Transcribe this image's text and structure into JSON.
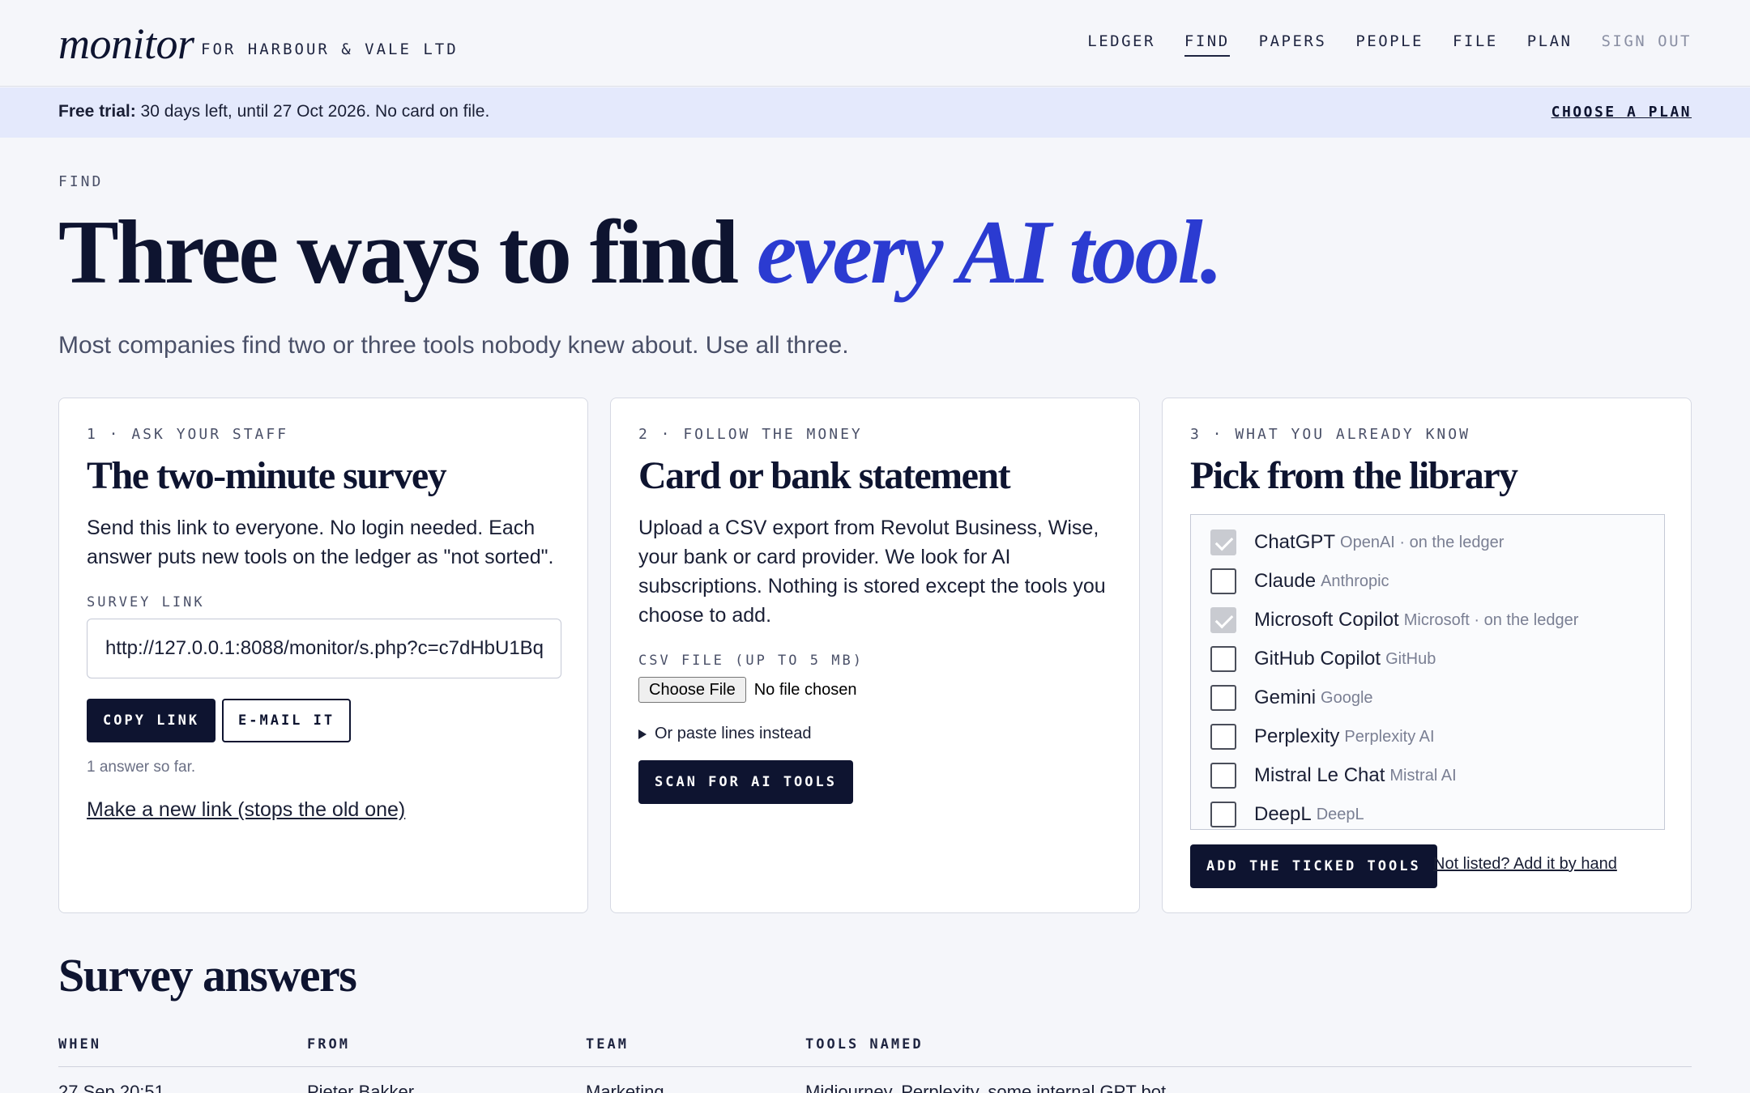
{
  "header": {
    "logo": "monitor",
    "org": "FOR HARBOUR & VALE LTD",
    "nav": [
      {
        "label": "LEDGER"
      },
      {
        "label": "FIND"
      },
      {
        "label": "PAPERS"
      },
      {
        "label": "PEOPLE"
      },
      {
        "label": "FILE"
      },
      {
        "label": "PLAN"
      },
      {
        "label": "SIGN OUT"
      }
    ],
    "active_nav": "FIND"
  },
  "trial": {
    "label": "Free trial:",
    "text": " 30 days left, until 27 Oct 2026. No card on file.",
    "cta": "CHOOSE A PLAN"
  },
  "page": {
    "eyebrow": "FIND",
    "title_plain": "Three ways to find ",
    "title_accent": "every AI tool.",
    "lede": "Most companies find two or three tools nobody knew about. Use all three."
  },
  "cards": {
    "survey": {
      "step": "1 · ASK YOUR STAFF",
      "title": "The two-minute survey",
      "body": "Send this link to everyone. No login needed. Each answer puts new tools on the ledger as \"not sorted\".",
      "field_label": "SURVEY LINK",
      "url": "http://127.0.0.1:8088/monitor/s.php?c=c7dHbU1Bq",
      "copy_label": "COPY LINK",
      "email_label": "E-MAIL IT",
      "answer_count": "1 answer so far.",
      "new_link": "Make a new link (stops the old one)"
    },
    "money": {
      "step": "2 · FOLLOW THE MONEY",
      "title": "Card or bank statement",
      "body": "Upload a CSV export from Revolut Business, Wise, your bank or card provider. We look for AI subscriptions. Nothing is stored except the tools you choose to add.",
      "field_label": "CSV FILE (UP TO 5 MB)",
      "choose_file": "Choose File",
      "file_status": "No file chosen",
      "paste": "Or paste lines instead",
      "scan_label": "SCAN FOR AI TOOLS"
    },
    "library": {
      "step": "3 · WHAT YOU ALREADY KNOW",
      "title": "Pick from the library",
      "items": [
        {
          "name": "ChatGPT",
          "meta": "OpenAI · on the ledger",
          "checked": true
        },
        {
          "name": "Claude",
          "meta": "Anthropic",
          "checked": false
        },
        {
          "name": "Microsoft Copilot",
          "meta": "Microsoft · on the ledger",
          "checked": true
        },
        {
          "name": "GitHub Copilot",
          "meta": "GitHub",
          "checked": false
        },
        {
          "name": "Gemini",
          "meta": "Google",
          "checked": false
        },
        {
          "name": "Perplexity",
          "meta": "Perplexity AI",
          "checked": false
        },
        {
          "name": "Mistral Le Chat",
          "meta": "Mistral AI",
          "checked": false
        },
        {
          "name": "DeepL",
          "meta": "DeepL",
          "checked": false
        }
      ],
      "add_label": "ADD THE TICKED TOOLS",
      "manual_link": "Not listed? Add it by hand"
    }
  },
  "survey_answers": {
    "title": "Survey answers",
    "columns": [
      "WHEN",
      "FROM",
      "TEAM",
      "TOOLS NAMED"
    ],
    "rows": [
      {
        "when": "27 Sep 20:51",
        "from": "Pieter Bakker",
        "team": "Marketing",
        "tools": "Midjourney, Perplexity, some internal GPT bot"
      }
    ]
  },
  "colors": {
    "ink": "#0e1430",
    "accent": "#2b3bd1",
    "banner": "#e4e9fc",
    "background": "#f5f6fa"
  }
}
